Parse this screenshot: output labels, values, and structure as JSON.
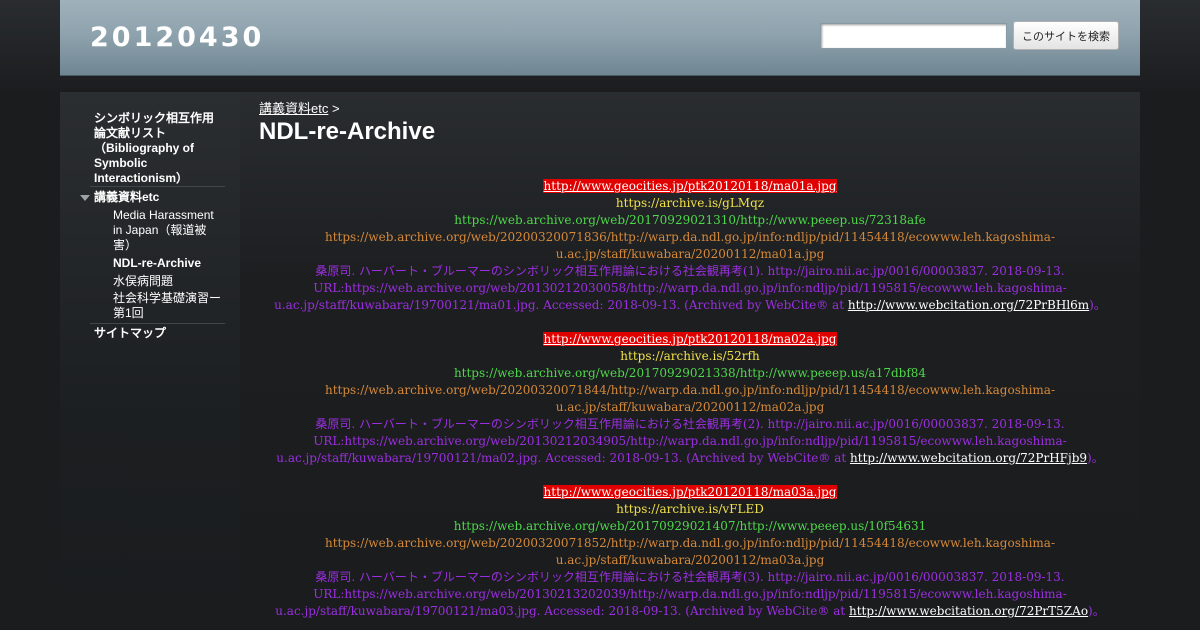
{
  "header": {
    "site_title": "20120430",
    "search_button": "このサイトを検索",
    "search_value": ""
  },
  "sidebar": {
    "items": [
      {
        "label_lines": [
          "シンボリック相互作用",
          "論文献リスト",
          "（Bibliography of",
          "Symbolic",
          "Interactionism）"
        ]
      },
      {
        "label": "講義資料etc"
      },
      {
        "label_lines": [
          "Media Harassment",
          "in Japan（報道被",
          "害）"
        ]
      },
      {
        "label": "NDL-re-Archive"
      },
      {
        "label": "水俣病問題"
      },
      {
        "label_lines": [
          "社会科学基礎演習ー",
          "第1回"
        ]
      },
      {
        "label": "サイトマップ"
      }
    ]
  },
  "breadcrumb": {
    "parent": "講義資料etc",
    "separator": ">"
  },
  "page_title": "NDL-re-Archive",
  "entries": [
    {
      "geocities": "http://www.geocities.jp/ptk20120118/ma01a.jpg",
      "archive_is": "https://archive.is/gLMqz",
      "wayback": "https://web.archive.org/web/20170929021310/http://www.peeep.us/72318afe",
      "ndl_line1": "https://web.archive.org/web/20200320071836/http://warp.da.ndl.go.jp/info:ndljp/pid/11454418/ecowww.leh.kagoshima-",
      "ndl_line2": "u.ac.jp/staff/kuwabara/20200112/ma01a.jpg",
      "cite_line1": "桑原司. ハーバート・ブルーマーのシンボリック相互作用論における社会観再考(1). http://jairo.nii.ac.jp/0016/00003837. 2018-09-13.",
      "cite_line2": "URL:https://web.archive.org/web/20130212030058/http://warp.da.ndl.go.jp/info:ndljp/pid/1195815/ecowww.leh.kagoshima-",
      "cite_line3": "u.ac.jp/staff/kuwabara/19700121/ma01.jpg. Accessed: 2018-09-13. (Archived by WebCite® at",
      "webcite": "http://www.webcitation.org/72PrBHl6m",
      "cite_end": ")。"
    },
    {
      "geocities": "http://www.geocities.jp/ptk20120118/ma02a.jpg",
      "archive_is": "https://archive.is/52rfh",
      "wayback": "https://web.archive.org/web/20170929021338/http://www.peeep.us/a17dbf84",
      "ndl_line1": "https://web.archive.org/web/20200320071844/http://warp.da.ndl.go.jp/info:ndljp/pid/11454418/ecowww.leh.kagoshima-",
      "ndl_line2": "u.ac.jp/staff/kuwabara/20200112/ma02a.jpg",
      "cite_line1": "桑原司. ハーバート・ブルーマーのシンボリック相互作用論における社会観再考(2). http://jairo.nii.ac.jp/0016/00003837. 2018-09-13.",
      "cite_line2": "URL:https://web.archive.org/web/20130212034905/http://warp.da.ndl.go.jp/info:ndljp/pid/1195815/ecowww.leh.kagoshima-",
      "cite_line3": "u.ac.jp/staff/kuwabara/19700121/ma02.jpg. Accessed: 2018-09-13. (Archived by WebCite® at",
      "webcite": "http://www.webcitation.org/72PrHFjb9",
      "cite_end": ")。"
    },
    {
      "geocities": "http://www.geocities.jp/ptk20120118/ma03a.jpg",
      "archive_is": "https://archive.is/vFLED",
      "wayback": "https://web.archive.org/web/20170929021407/http://www.peeep.us/10f54631",
      "ndl_line1": "https://web.archive.org/web/20200320071852/http://warp.da.ndl.go.jp/info:ndljp/pid/11454418/ecowww.leh.kagoshima-",
      "ndl_line2": "u.ac.jp/staff/kuwabara/20200112/ma03a.jpg",
      "cite_line1": "桑原司. ハーバート・ブルーマーのシンボリック相互作用論における社会観再考(3). http://jairo.nii.ac.jp/0016/00003837. 2018-09-13.",
      "cite_line2": "URL:https://web.archive.org/web/20130213202039/http://warp.da.ndl.go.jp/info:ndljp/pid/1195815/ecowww.leh.kagoshima-",
      "cite_line3": "u.ac.jp/staff/kuwabara/19700121/ma03.jpg. Accessed: 2018-09-13. (Archived by WebCite® at",
      "webcite": "http://www.webcitation.org/72PrT5ZAo",
      "cite_end": ")。"
    }
  ],
  "colors": {
    "geocities_bg": "#e00000",
    "archive_is": "#f2e14a",
    "wayback": "#4fd84b",
    "ndl": "#d6893a",
    "citation": "#9b2fe0"
  }
}
